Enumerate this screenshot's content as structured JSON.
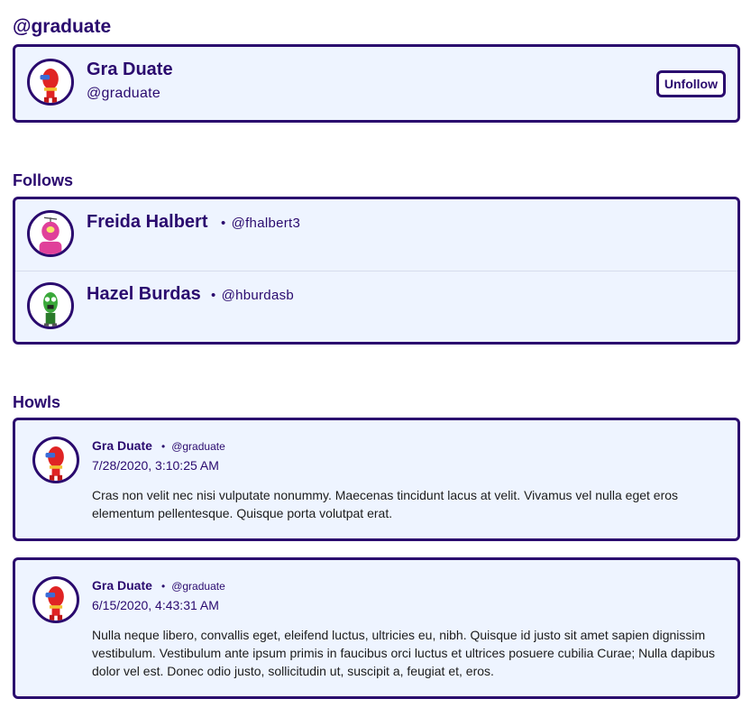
{
  "page": {
    "heading": "@graduate"
  },
  "profile": {
    "name": "Gra Duate",
    "handle": "@graduate",
    "avatar_icon": "red-robot-avatar",
    "unfollow_label": "Unfollow"
  },
  "follows": {
    "heading": "Follows",
    "items": [
      {
        "name": "Freida Halbert",
        "handle": "@fhalbert3",
        "avatar_icon": "pink-robot-avatar"
      },
      {
        "name": "Hazel Burdas",
        "handle": "@hburdasb",
        "avatar_icon": "green-robot-avatar"
      }
    ]
  },
  "howls": {
    "heading": "Howls",
    "items": [
      {
        "name": "Gra Duate",
        "handle": "@graduate",
        "timestamp": "7/28/2020, 3:10:25 AM",
        "text": "Cras non velit nec nisi vulputate nonummy. Maecenas tincidunt lacus at velit. Vivamus vel nulla eget eros elementum pellentesque. Quisque porta volutpat erat."
      },
      {
        "name": "Gra Duate",
        "handle": "@graduate",
        "timestamp": "6/15/2020, 4:43:31 AM",
        "text": "Nulla neque libero, convallis eget, eleifend luctus, ultricies eu, nibh. Quisque id justo sit amet sapien dignissim vestibulum. Vestibulum ante ipsum primis in faucibus orci luctus et ultrices posuere cubilia Curae; Nulla dapibus dolor vel est. Donec odio justo, sollicitudin ut, suscipit a, feugiat et, eros."
      }
    ]
  },
  "colors": {
    "accent": "#2a0a6e",
    "card_bg": "#eef4ff",
    "robot_red": "#e02424",
    "robot_pink": "#e0409a",
    "robot_green": "#3aa83a"
  }
}
